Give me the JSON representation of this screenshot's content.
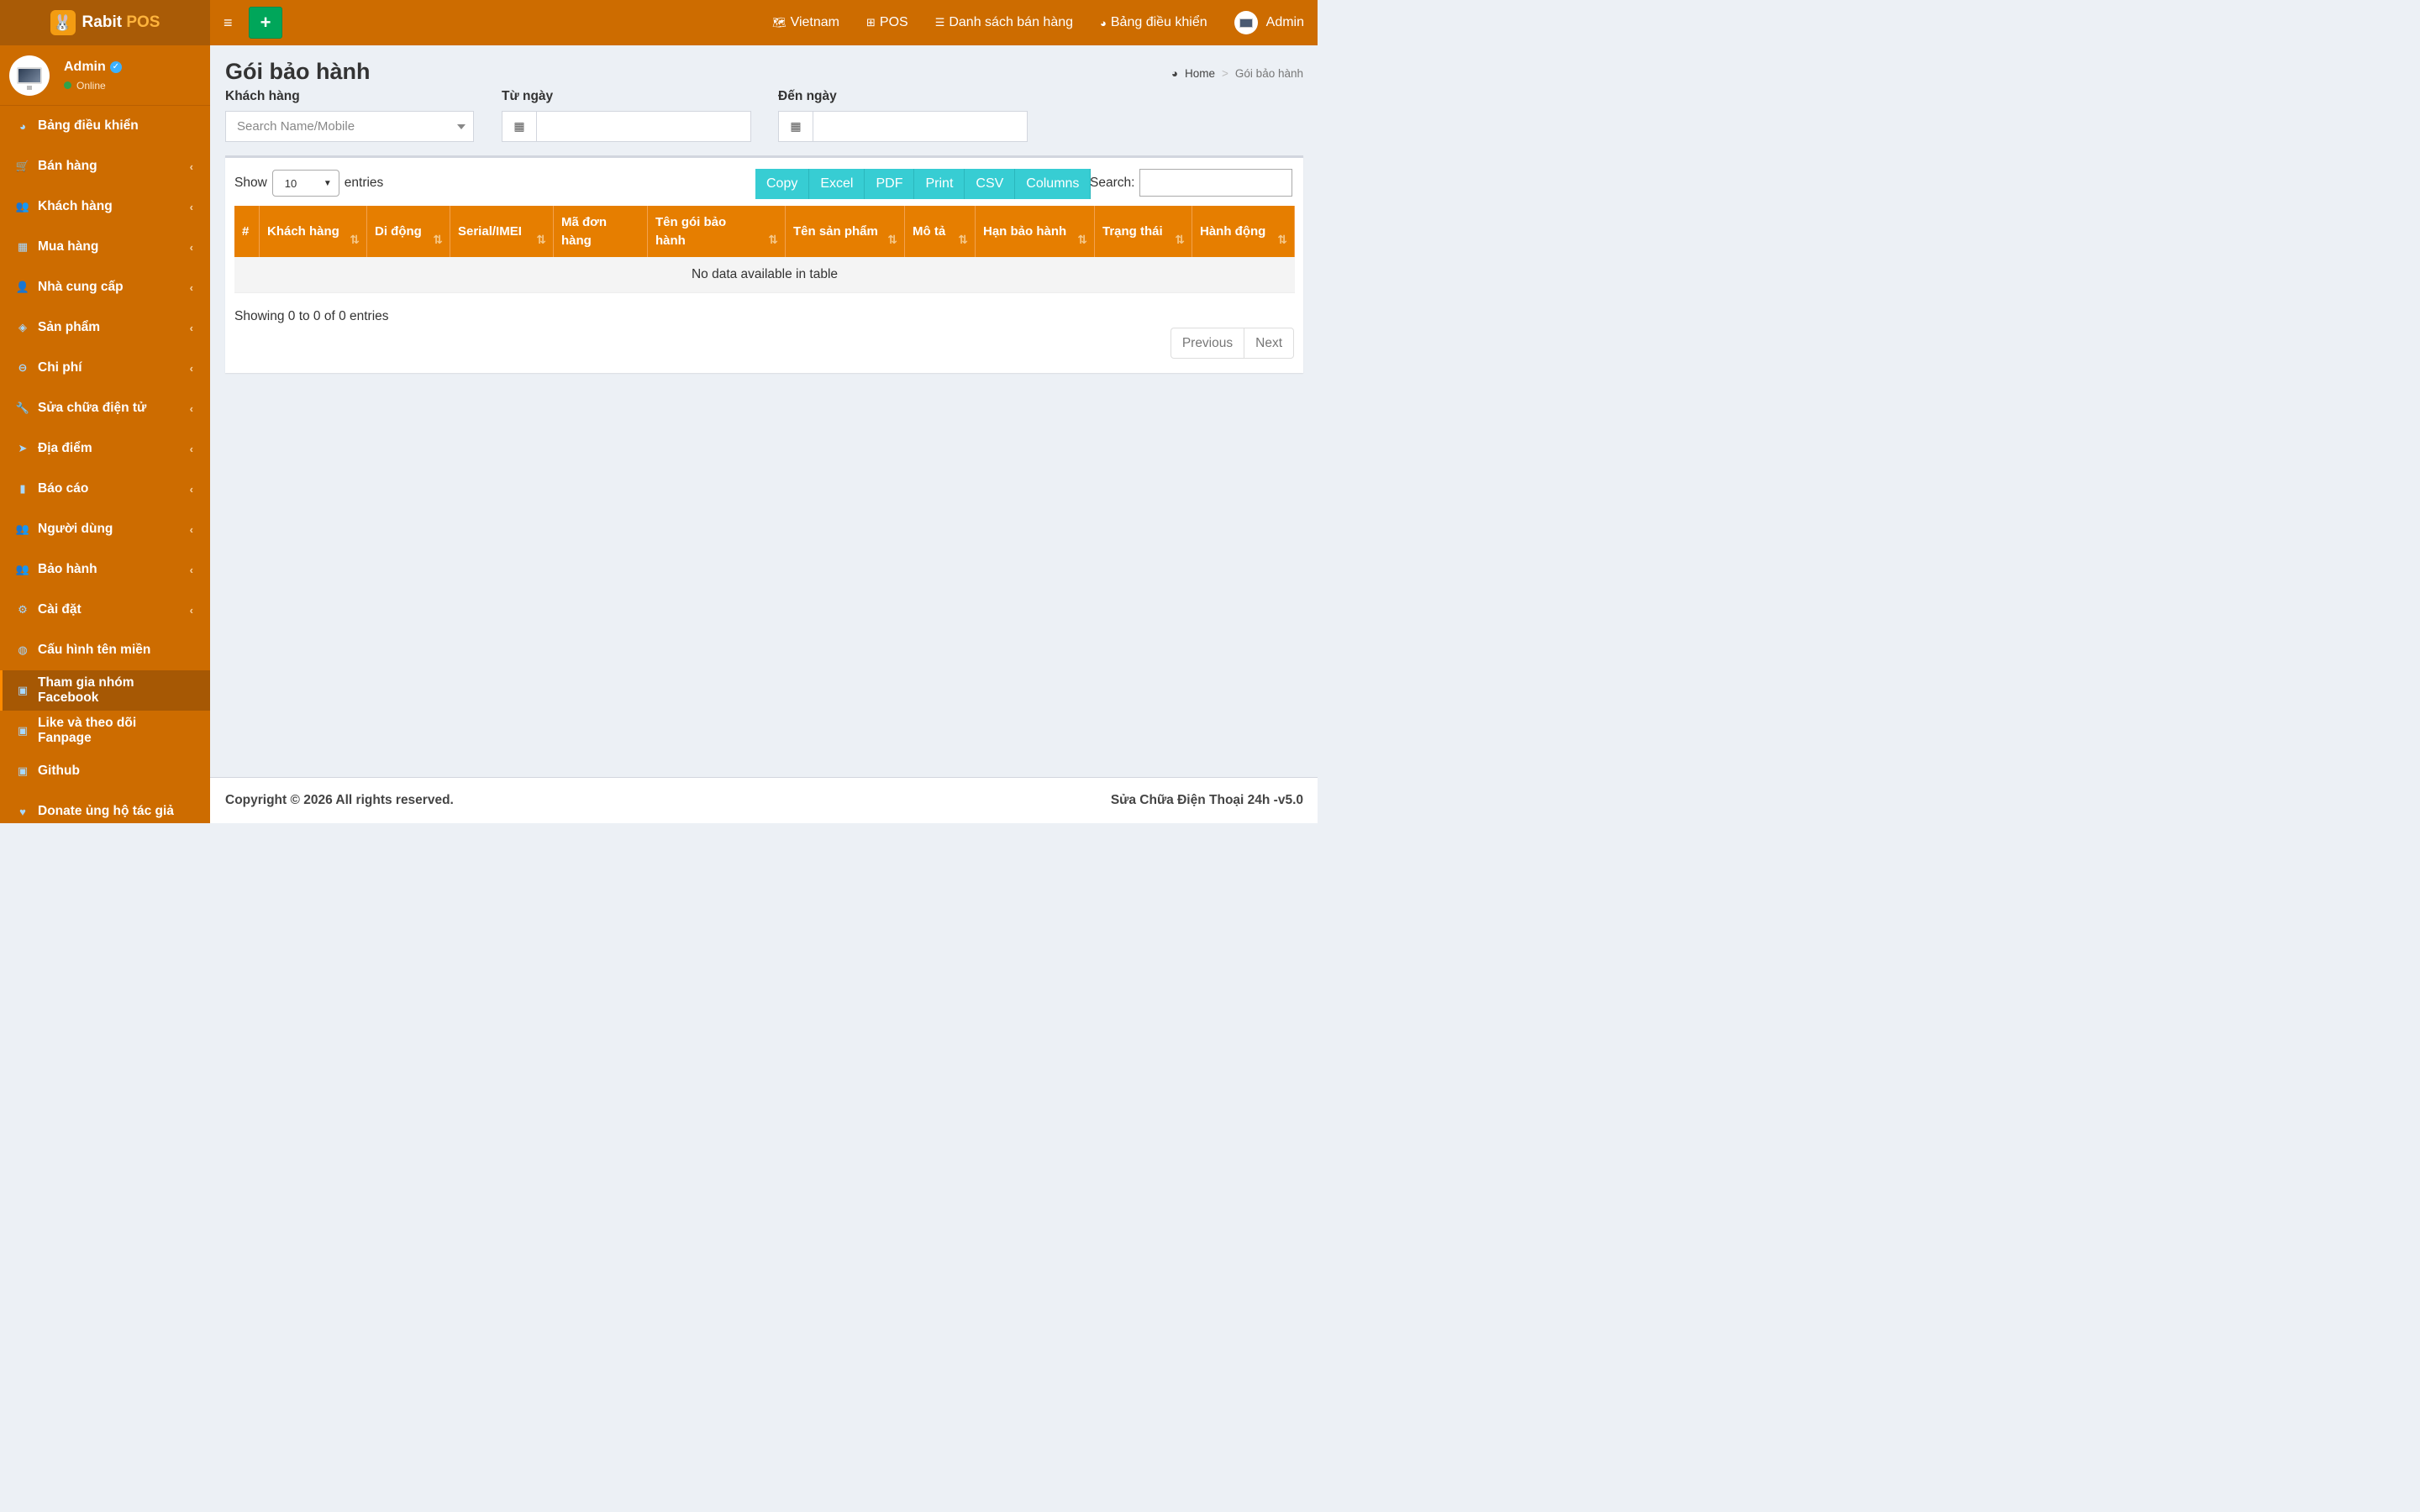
{
  "app": {
    "logo_main": "Rabit",
    "logo_accent": "POS"
  },
  "user": {
    "name": "Admin",
    "status": "Online"
  },
  "sidebar": {
    "items": [
      {
        "label": "Bảng điều khiển",
        "icon": "dashboard-icon",
        "glyph": "◕",
        "has_children": false
      },
      {
        "label": "Bán hàng",
        "icon": "cart-icon",
        "glyph": "🛒",
        "has_children": true
      },
      {
        "label": "Khách hàng",
        "icon": "users-icon",
        "glyph": "👥",
        "has_children": true
      },
      {
        "label": "Mua hàng",
        "icon": "grid-icon",
        "glyph": "▦",
        "has_children": true
      },
      {
        "label": "Nhà cung cấp",
        "icon": "user-plus-icon",
        "glyph": "👤",
        "has_children": true
      },
      {
        "label": "Sản phẩm",
        "icon": "cubes-icon",
        "glyph": "◈",
        "has_children": true
      },
      {
        "label": "Chi phí",
        "icon": "minus-circle-icon",
        "glyph": "⊖",
        "has_children": true
      },
      {
        "label": "Sửa chữa điện tử",
        "icon": "wrench-icon",
        "glyph": "🔧",
        "has_children": true
      },
      {
        "label": "Địa điểm",
        "icon": "paper-plane-icon",
        "glyph": "➤",
        "has_children": true
      },
      {
        "label": "Báo cáo",
        "icon": "bar-chart-icon",
        "glyph": "▮",
        "has_children": true
      },
      {
        "label": "Người dùng",
        "icon": "users-icon",
        "glyph": "👥",
        "has_children": true
      },
      {
        "label": "Bảo hành",
        "icon": "users-icon",
        "glyph": "👥",
        "has_children": true
      },
      {
        "label": "Cài đặt",
        "icon": "gears-icon",
        "glyph": "⚙",
        "has_children": true
      },
      {
        "label": "Cấu hình tên miền",
        "icon": "globe-icon",
        "glyph": "◍",
        "has_children": false
      },
      {
        "label": "Tham gia nhóm Facebook",
        "icon": "briefcase-icon",
        "glyph": "▣",
        "has_children": false,
        "active": true
      },
      {
        "label": "Like và theo dõi Fanpage",
        "icon": "briefcase-icon",
        "glyph": "▣",
        "has_children": false
      },
      {
        "label": "Github",
        "icon": "briefcase-icon",
        "glyph": "▣",
        "has_children": false
      },
      {
        "label": "Donate ủng hộ tác giả",
        "icon": "heart-icon",
        "glyph": "♥",
        "has_children": false
      }
    ]
  },
  "topnav": {
    "items": [
      {
        "label": "Vietnam",
        "icon": "language-icon",
        "glyph": "🗺"
      },
      {
        "label": "POS",
        "icon": "plus-square-icon",
        "glyph": "⊞"
      },
      {
        "label": "Danh sách bán hàng",
        "icon": "list-icon",
        "glyph": "☰"
      },
      {
        "label": "Bảng điều khiển",
        "icon": "dashboard-icon",
        "glyph": "◕"
      }
    ],
    "user_label": "Admin"
  },
  "page": {
    "title": "Gói bảo hành",
    "breadcrumb_home": "Home",
    "breadcrumb_sep": ">",
    "breadcrumb_current": "Gói bảo hành"
  },
  "filters": {
    "customer_label": "Khách hàng",
    "customer_placeholder": "Search Name/Mobile",
    "from_label": "Từ ngày",
    "to_label": "Đến ngày"
  },
  "table": {
    "show_label": "Show",
    "entries_label": "entries",
    "length_value": "10",
    "buttons": [
      "Copy",
      "Excel",
      "PDF",
      "Print",
      "CSV",
      "Columns"
    ],
    "search_label": "Search:",
    "columns": [
      {
        "label": "#",
        "sortable": false
      },
      {
        "label": "Khách hàng",
        "sortable": true
      },
      {
        "label": "Di động",
        "sortable": true
      },
      {
        "label": "Serial/IMEI",
        "sortable": true
      },
      {
        "label": "Mã đơn hàng",
        "sortable": false
      },
      {
        "label": "Tên gói bảo hành",
        "sortable": true
      },
      {
        "label": "Tên sản phẩm",
        "sortable": true
      },
      {
        "label": "Mô tả",
        "sortable": true
      },
      {
        "label": "Hạn bảo hành",
        "sortable": true
      },
      {
        "label": "Trạng thái",
        "sortable": true
      },
      {
        "label": "Hành động",
        "sortable": true
      }
    ],
    "empty_message": "No data available in table",
    "info": "Showing 0 to 0 of 0 entries",
    "prev_label": "Previous",
    "next_label": "Next"
  },
  "footer": {
    "left": "Copyright © 2026 All rights reserved.",
    "right": "Sửa Chữa Điện Thoại 24h -v5.0"
  },
  "colors": {
    "sidebar": "#cd6c00",
    "header_dark": "#a95b06",
    "table_header": "#e67e00",
    "export_buttons": "#37cdd3",
    "add_button": "#00a65a"
  }
}
